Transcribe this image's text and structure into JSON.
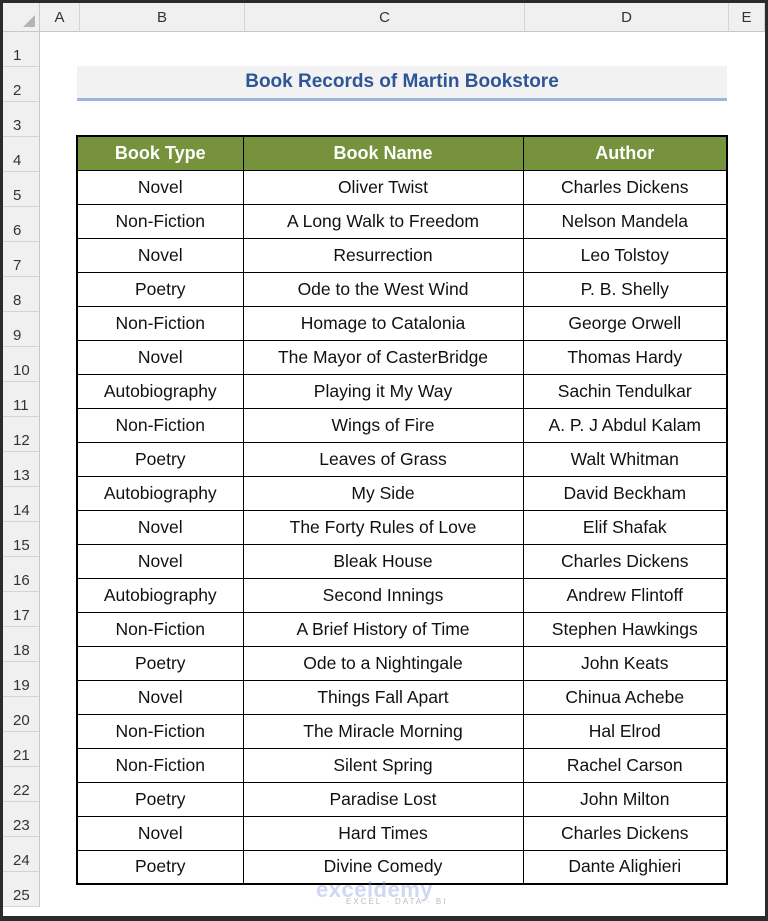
{
  "columns": [
    "A",
    "B",
    "C",
    "D",
    "E"
  ],
  "rows": [
    "1",
    "2",
    "3",
    "4",
    "5",
    "6",
    "7",
    "8",
    "9",
    "10",
    "11",
    "12",
    "13",
    "14",
    "15",
    "16",
    "17",
    "18",
    "19",
    "20",
    "21",
    "22",
    "23",
    "24",
    "25"
  ],
  "title": "Book Records of Martin Bookstore",
  "table": {
    "headers": [
      "Book Type",
      "Book Name",
      "Author"
    ],
    "rows": [
      [
        "Novel",
        "Oliver Twist",
        "Charles Dickens"
      ],
      [
        "Non-Fiction",
        "A Long Walk to Freedom",
        "Nelson Mandela"
      ],
      [
        "Novel",
        "Resurrection",
        "Leo Tolstoy"
      ],
      [
        "Poetry",
        "Ode to the West Wind",
        "P. B. Shelly"
      ],
      [
        "Non-Fiction",
        "Homage to Catalonia",
        "George Orwell"
      ],
      [
        "Novel",
        "The Mayor of CasterBridge",
        "Thomas Hardy"
      ],
      [
        "Autobiography",
        "Playing it My Way",
        "Sachin Tendulkar"
      ],
      [
        "Non-Fiction",
        "Wings of Fire",
        "A. P. J Abdul Kalam"
      ],
      [
        "Poetry",
        "Leaves of Grass",
        "Walt Whitman"
      ],
      [
        "Autobiography",
        "My Side",
        "David Beckham"
      ],
      [
        "Novel",
        "The Forty Rules of Love",
        "Elif Shafak"
      ],
      [
        "Novel",
        "Bleak House",
        "Charles Dickens"
      ],
      [
        "Autobiography",
        "Second Innings",
        "Andrew Flintoff"
      ],
      [
        "Non-Fiction",
        "A Brief History of Time",
        "Stephen Hawkings"
      ],
      [
        "Poetry",
        "Ode to a Nightingale",
        "John Keats"
      ],
      [
        "Novel",
        "Things Fall Apart",
        "Chinua Achebe"
      ],
      [
        "Non-Fiction",
        "The Miracle Morning",
        "Hal Elrod"
      ],
      [
        "Non-Fiction",
        "Silent Spring",
        "Rachel Carson"
      ],
      [
        "Poetry",
        "Paradise Lost",
        "John Milton"
      ],
      [
        "Novel",
        "Hard Times",
        "Charles Dickens"
      ],
      [
        "Poetry",
        "Divine Comedy",
        "Dante Alighieri"
      ]
    ]
  },
  "watermark": {
    "name": "exceldemy",
    "tagline": "EXCEL · DATA · BI"
  },
  "colors": {
    "header_bg": "#76923c",
    "title_text": "#2e5597",
    "title_underline": "#9bb5dc"
  }
}
